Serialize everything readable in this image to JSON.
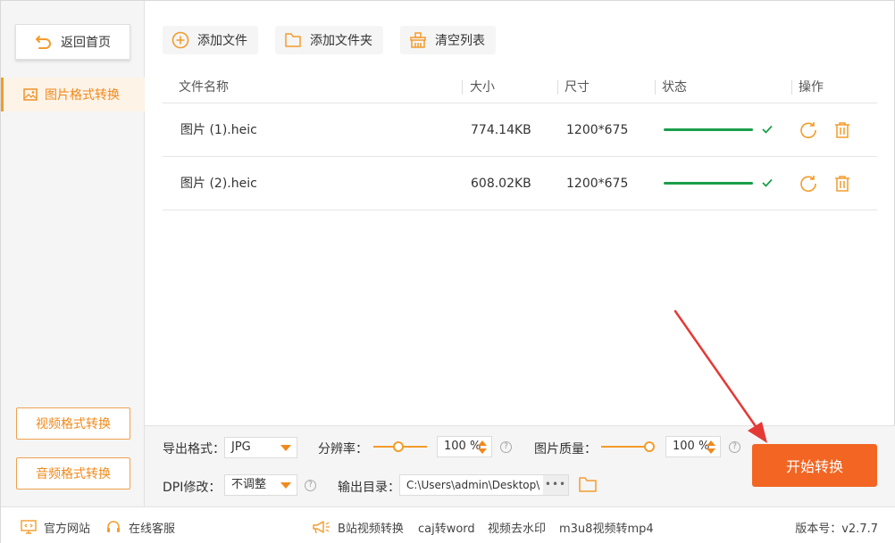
{
  "sidebar": {
    "back_label": "返回首页",
    "active_item": "图片格式转换",
    "video_btn": "视频格式转换",
    "audio_btn": "音频格式转换"
  },
  "toolbar": {
    "add_file": "添加文件",
    "add_folder": "添加文件夹",
    "clear_list": "清空列表"
  },
  "table": {
    "headers": [
      "文件名称",
      "大小",
      "尺寸",
      "状态",
      "操作"
    ],
    "rows": [
      {
        "name": "图片 (1).heic",
        "size": "774.14KB",
        "dimensions": "1200*675",
        "progress": 1.0
      },
      {
        "name": "图片 (2).heic",
        "size": "608.02KB",
        "dimensions": "1200*675",
        "progress": 1.0
      }
    ]
  },
  "settings": {
    "format_label": "导出格式：",
    "format_value": "JPG",
    "resolution_label": "分辨率：",
    "resolution_value": "100 %",
    "quality_label": "图片质量：",
    "quality_value": "100 %",
    "dpi_label": "DPI修改：",
    "dpi_value": "不调整",
    "output_label": "输出目录：",
    "output_path": "C:\\Users\\admin\\Desktop\\",
    "browse": "•••",
    "start": "开始转换"
  },
  "footer": {
    "website": "官方网站",
    "support": "在线客服",
    "link1": "B站视频转换",
    "link2": "caj转word",
    "link3": "视频去水印",
    "link4": "m3u8视频转mp4",
    "version": "版本号：v2.7.7"
  },
  "colors": {
    "accent": "#f39c2c",
    "primary_button": "#f26522",
    "progress": "#1a9e4a",
    "arrow": "#e53935"
  }
}
